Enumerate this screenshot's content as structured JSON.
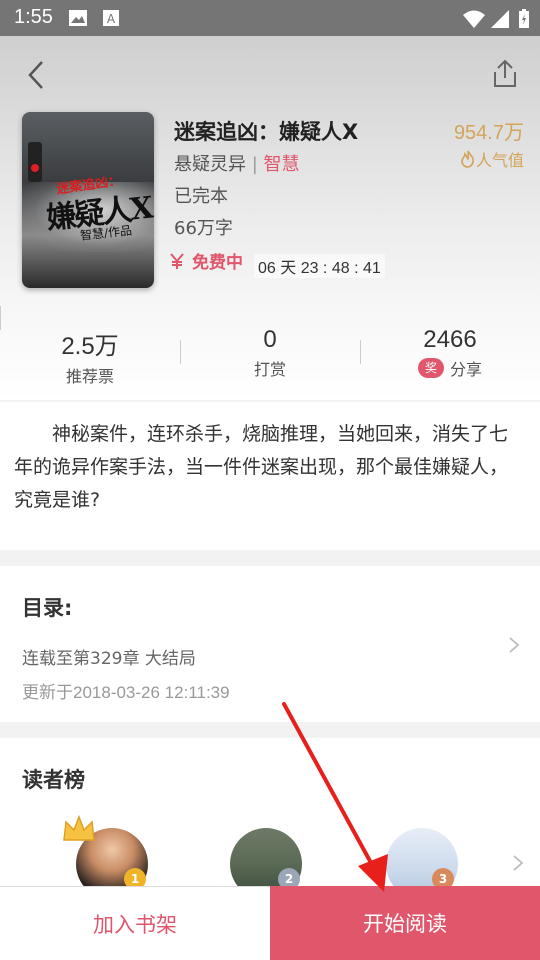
{
  "status_bar": {
    "time": "1:55"
  },
  "book": {
    "title": "迷案追凶：嫌疑人X",
    "category": "悬疑灵异",
    "separator": "|",
    "author": "智慧",
    "status": "已完本",
    "word_count": "66万字",
    "free_label": "免费中",
    "countdown": "06 天 23 : 48 : 41",
    "cover": {
      "title_red": "迷案追凶：",
      "title_main": "嫌疑人X",
      "author_line": "智慧/作品"
    }
  },
  "popularity": {
    "value": "954.7万",
    "label": "人气值"
  },
  "stats": [
    {
      "value": "2.5万",
      "label": "推荐票"
    },
    {
      "value": "0",
      "label": "打赏"
    },
    {
      "value": "2466",
      "label": "分享",
      "badge": "奖"
    }
  ],
  "description": "神秘案件，连环杀手，烧脑推理，当她回来，消失了七年的诡异作案手法，当一件件迷案出现，那个最佳嫌疑人，究竟是谁?",
  "catalog": {
    "title": "目录:",
    "latest": "连载至第329章 大结局",
    "updated": "更新于2018-03-26 12:11:39"
  },
  "readers": {
    "title": "读者榜",
    "ranks": [
      "1",
      "2",
      "3"
    ]
  },
  "bottom": {
    "add_shelf": "加入书架",
    "start_read": "开始阅读"
  },
  "colors": {
    "accent": "#e0566b",
    "gold": "#d4a35a",
    "annotation_arrow": "#e8201c"
  },
  "icons": [
    "back-arrow-icon",
    "share-icon",
    "flame-icon",
    "yen-icon",
    "award-icon",
    "chevron-right-icon",
    "crown-icon"
  ]
}
